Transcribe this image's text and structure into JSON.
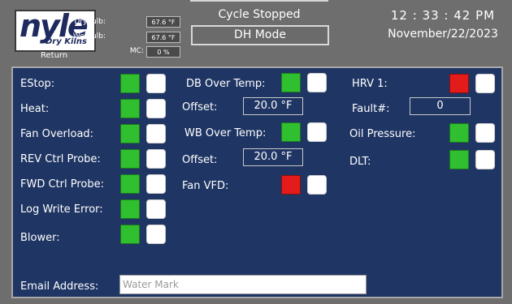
{
  "header": {
    "logo_text": "nyle",
    "logo_subtext": "Dry Kilns",
    "return_label": "Return",
    "drybulb_label": "Drybulb:",
    "drybulb_value": "67.6 °F",
    "wetbulb_label": "Wetbulb:",
    "wetbulb_value": "67.6 °F",
    "mc_label": "MC:",
    "mc_value": "0 %",
    "cycle_status": "Cycle Stopped",
    "mode_label": "DH Mode",
    "time": "12 : 33 : 42  PM",
    "date": "November/22/2023"
  },
  "colors": {
    "panel_bg": "#1f3563",
    "ok": "#2fbf2f",
    "alarm": "#e31b1b",
    "frame": "#6e6e6e"
  },
  "alarms_col1": [
    {
      "label": "EStop:",
      "state": "ok"
    },
    {
      "label": "Heat:",
      "state": "ok"
    },
    {
      "label": "Fan Overload:",
      "state": "ok"
    },
    {
      "label": "REV Ctrl Probe:",
      "state": "ok"
    },
    {
      "label": "FWD Ctrl Probe:",
      "state": "ok"
    },
    {
      "label": "Log Write Error:",
      "state": "ok"
    },
    {
      "label": "Blower:",
      "state": "ok"
    }
  ],
  "alarms_col2": {
    "db_over_temp_label": "DB Over Temp:",
    "db_offset_label": "Offset:",
    "db_offset_value": "20.0 °F",
    "wb_over_temp_label": "WB Over Temp:",
    "wb_offset_label": "Offset:",
    "wb_offset_value": "20.0 °F",
    "fan_vfd_label": "Fan VFD:"
  },
  "alarms_col3": {
    "hrv1_label": "HRV 1:",
    "fault_label": "Fault#:",
    "fault_value": "0",
    "oil_pressure_label": "Oil Pressure:",
    "dlt_label": "DLT:"
  },
  "email": {
    "label": "Email Address:",
    "placeholder": "Water Mark"
  }
}
